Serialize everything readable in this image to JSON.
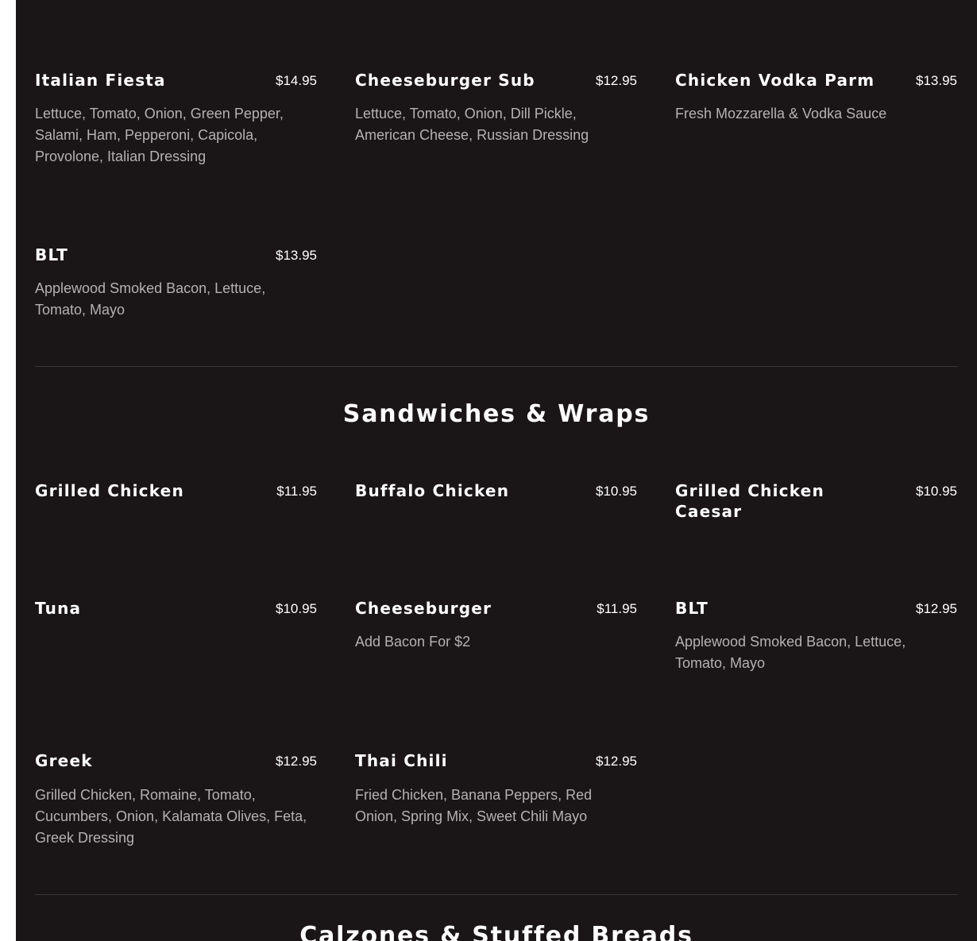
{
  "sections": [
    {
      "title": "",
      "items": [
        {
          "name": "Italian Fiesta",
          "price": "$14.95",
          "description": "Lettuce, Tomato, Onion, Green Pepper, Salami, Ham, Pepperoni, Capicola, Provolone, Italian Dressing"
        },
        {
          "name": "Cheeseburger Sub",
          "price": "$12.95",
          "description": "Lettuce, Tomato, Onion, Dill Pickle, American Cheese, Russian Dressing"
        },
        {
          "name": "Chicken Vodka Parm",
          "price": "$13.95",
          "description": "Fresh Mozzarella & Vodka Sauce"
        },
        {
          "name": "BLT",
          "price": "$13.95",
          "description": "Applewood Smoked Bacon, Lettuce, Tomato, Mayo"
        }
      ]
    },
    {
      "title": "Sandwiches & Wraps",
      "items": [
        {
          "name": "Grilled Chicken",
          "price": "$11.95",
          "description": ""
        },
        {
          "name": "Buffalo Chicken",
          "price": "$10.95",
          "description": ""
        },
        {
          "name": "Grilled Chicken Caesar",
          "price": "$10.95",
          "description": ""
        },
        {
          "name": "Tuna",
          "price": "$10.95",
          "description": ""
        },
        {
          "name": "Cheeseburger",
          "price": "$11.95",
          "description": "Add Bacon For $2"
        },
        {
          "name": "BLT",
          "price": "$12.95",
          "description": "Applewood Smoked Bacon, Lettuce, Tomato, Mayo"
        },
        {
          "name": "Greek",
          "price": "$12.95",
          "description": "Grilled Chicken, Romaine, Tomato, Cucumbers, Onion, Kalamata Olives, Feta, Greek Dressing"
        },
        {
          "name": "Thai Chili",
          "price": "$12.95",
          "description": "Fried Chicken, Banana Peppers, Red Onion, Spring Mix, Sweet Chili Mayo"
        }
      ]
    },
    {
      "title": "Calzones & Stuffed Breads",
      "items": []
    }
  ]
}
